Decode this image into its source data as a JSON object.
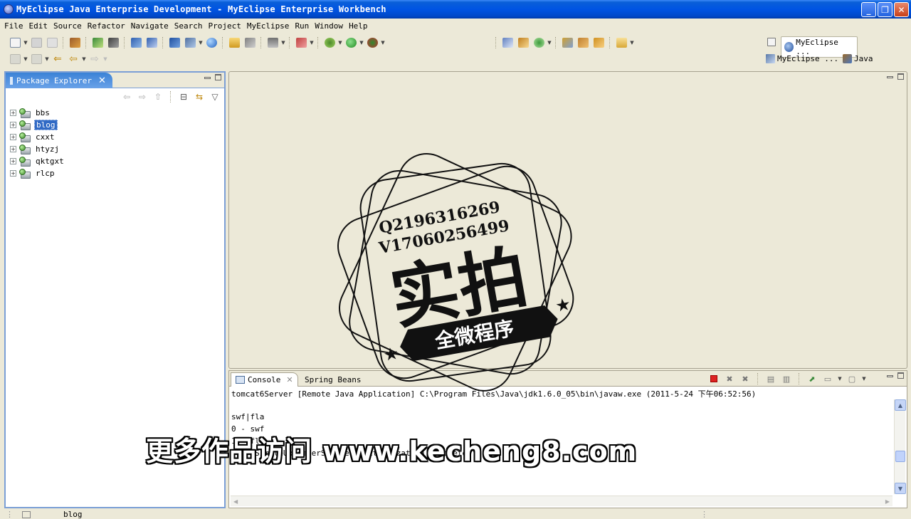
{
  "window": {
    "title": "MyEclipse Java Enterprise Development - MyEclipse Enterprise Workbench",
    "buttons": [
      "_",
      "❐",
      "✕"
    ]
  },
  "menu": [
    "File",
    "Edit",
    "Source",
    "Refactor",
    "Navigate",
    "Search",
    "Project",
    "MyEclipse",
    "Run",
    "Window",
    "Help"
  ],
  "perspectives": {
    "active": "MyEclipse ...",
    "others": [
      "MyEclipse ...",
      "Java"
    ]
  },
  "package_explorer": {
    "title": "Package Explorer",
    "projects": [
      {
        "name": "bbs",
        "selected": false
      },
      {
        "name": "blog",
        "selected": true
      },
      {
        "name": "cxxt",
        "selected": false
      },
      {
        "name": "htyzj",
        "selected": false
      },
      {
        "name": "qktgxt",
        "selected": false
      },
      {
        "name": "rlcp",
        "selected": false
      }
    ]
  },
  "console": {
    "tabs": [
      "Console",
      "Spring Beans"
    ],
    "header": "tomcat6Server [Remote Java Application] C:\\Program Files\\Java\\jdk1.6.0_05\\bin\\javaw.exe (2011-5-24 下午06:52:56)",
    "lines": [
      "swf|fla",
      "0 - swf",
      "1 - fla",
      "---- SimpleUploaderServlet initialization completed ----"
    ]
  },
  "statusbar": {
    "text": "blog"
  },
  "watermark": {
    "line1": "Q2196316269",
    "line2": "V17060256499",
    "main": "实拍",
    "banner": "全微程序",
    "overlay": "更多作品访问 www.kecheng8.com"
  },
  "colors": {
    "titlebar": "#0054e3",
    "selection": "#316ac5",
    "active_tab": "#3b82d6",
    "chrome": "#ece9d8"
  }
}
